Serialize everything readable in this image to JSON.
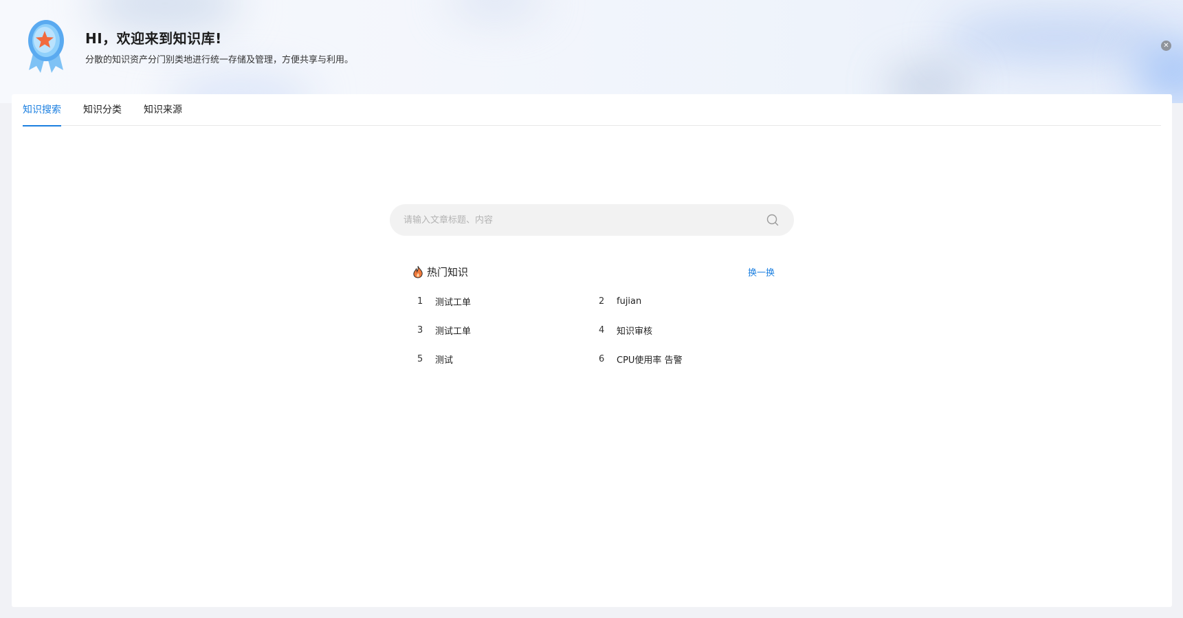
{
  "banner": {
    "greeting": "HI，欢迎来到知识库!",
    "description": "分散的知识资产分门别类地进行统一存储及管理，方便共享与利用。"
  },
  "tabs": [
    {
      "label": "知识搜索",
      "active": true
    },
    {
      "label": "知识分类",
      "active": false
    },
    {
      "label": "知识来源",
      "active": false
    }
  ],
  "search": {
    "placeholder": "请输入文章标题、内容",
    "value": ""
  },
  "hot": {
    "title": "热门知识",
    "refresh_label": "换一换",
    "items": [
      {
        "rank": "1",
        "title": "测试工单"
      },
      {
        "rank": "2",
        "title": "fujian"
      },
      {
        "rank": "3",
        "title": "测试工单"
      },
      {
        "rank": "4",
        "title": "知识审核"
      },
      {
        "rank": "5",
        "title": "测试"
      },
      {
        "rank": "6",
        "title": "CPU使用率 告警"
      }
    ]
  },
  "colors": {
    "accent": "#1b7fe0",
    "fire": "#f07a3b",
    "medal_blue": "#4aa3f0",
    "medal_star": "#f26a3d"
  },
  "icons": {
    "medal": "medal-icon",
    "close": "close-icon",
    "search": "search-icon",
    "fire": "fire-icon"
  }
}
